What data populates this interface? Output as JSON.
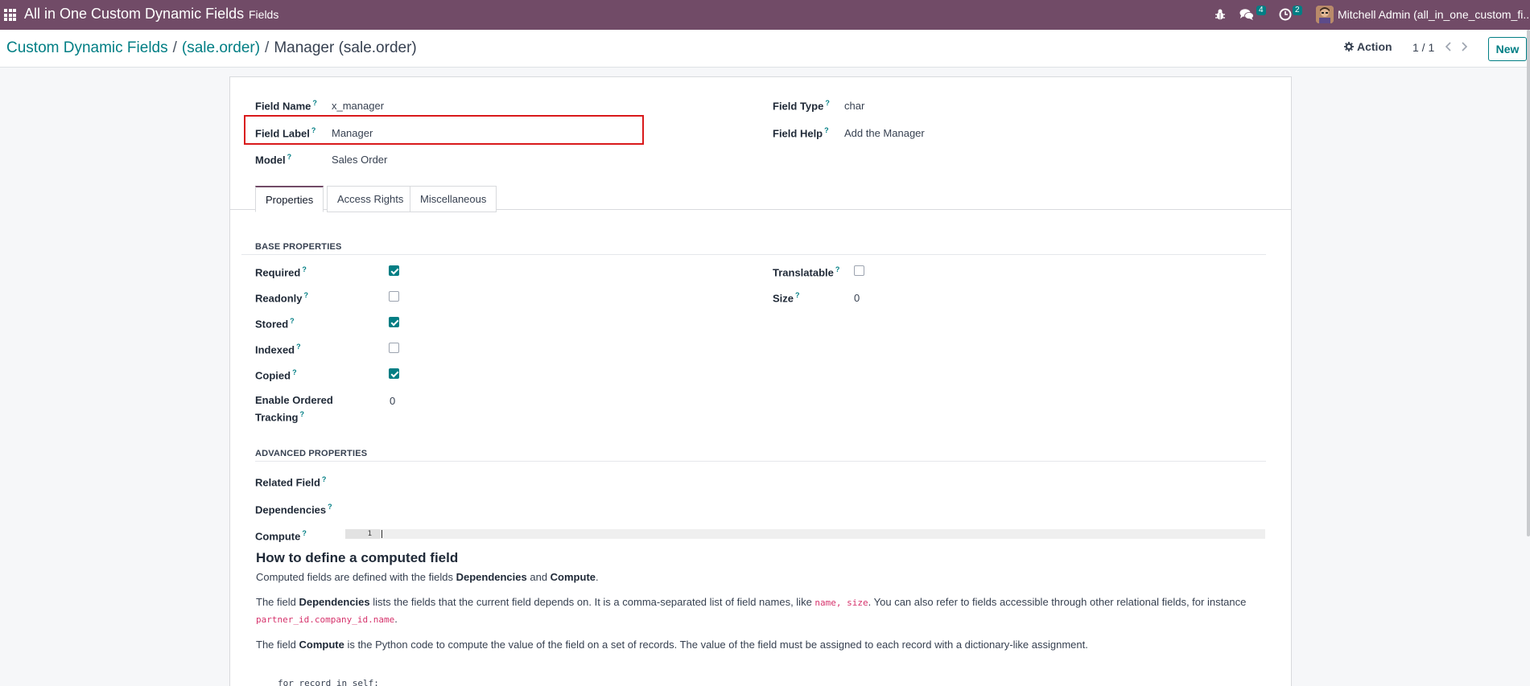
{
  "topbar": {
    "app_title": "All in One Custom Dynamic Fields",
    "menu_fields": "Fields",
    "messages_count": "4",
    "activities_count": "2",
    "user_name": "Mitchell Admin (all_in_one_custom_fi..."
  },
  "control": {
    "breadcrumb": [
      "Custom Dynamic Fields",
      "(sale.order)",
      "Manager (sale.order)"
    ],
    "separator": "/",
    "action_label": "Action",
    "pager": "1 / 1",
    "new_label": "New"
  },
  "form": {
    "field_name_label": "Field Name",
    "field_name_value": "x_manager",
    "field_label_label": "Field Label",
    "field_label_value": "Manager",
    "model_label": "Model",
    "model_value": "Sales Order",
    "field_type_label": "Field Type",
    "field_type_value": "char",
    "field_help_label": "Field Help",
    "field_help_value": "Add the Manager",
    "help_mark": "?"
  },
  "tabs": [
    "Properties",
    "Access Rights",
    "Miscellaneous"
  ],
  "base_properties": {
    "title": "BASE PROPERTIES",
    "required_label": "Required",
    "required": true,
    "readonly_label": "Readonly",
    "readonly": false,
    "stored_label": "Stored",
    "stored": true,
    "indexed_label": "Indexed",
    "indexed": false,
    "copied_label": "Copied",
    "copied": true,
    "tracking_label_1": "Enable Ordered",
    "tracking_label_2": "Tracking",
    "tracking_value": "0",
    "translatable_label": "Translatable",
    "translatable": false,
    "size_label": "Size",
    "size_value": "0"
  },
  "advanced_properties": {
    "title": "ADVANCED PROPERTIES",
    "related_field_label": "Related Field",
    "dependencies_label": "Dependencies",
    "compute_label": "Compute",
    "line_number": "1"
  },
  "help": {
    "title": "How to define a computed field",
    "p1_a": "Computed fields are defined with the fields ",
    "p1_b": "Dependencies",
    "p1_c": " and ",
    "p1_d": "Compute",
    "p1_e": ".",
    "p2_a": "The field ",
    "p2_b": "Dependencies",
    "p2_c": " lists the fields that the current field depends on. It is a comma-separated list of field names, like ",
    "p2_code1": "name, size",
    "p2_d": ". You can also refer to fields accessible through other relational fields, for instance ",
    "p2_code2": "partner_id.company_id.name",
    "p2_e": ".",
    "p3_a": "The field ",
    "p3_b": "Compute",
    "p3_c": " is the Python code to compute the value of the field on a set of records. The value of the field must be assigned to each record with a dictionary-like assignment.",
    "code_line": "for record in self:"
  }
}
